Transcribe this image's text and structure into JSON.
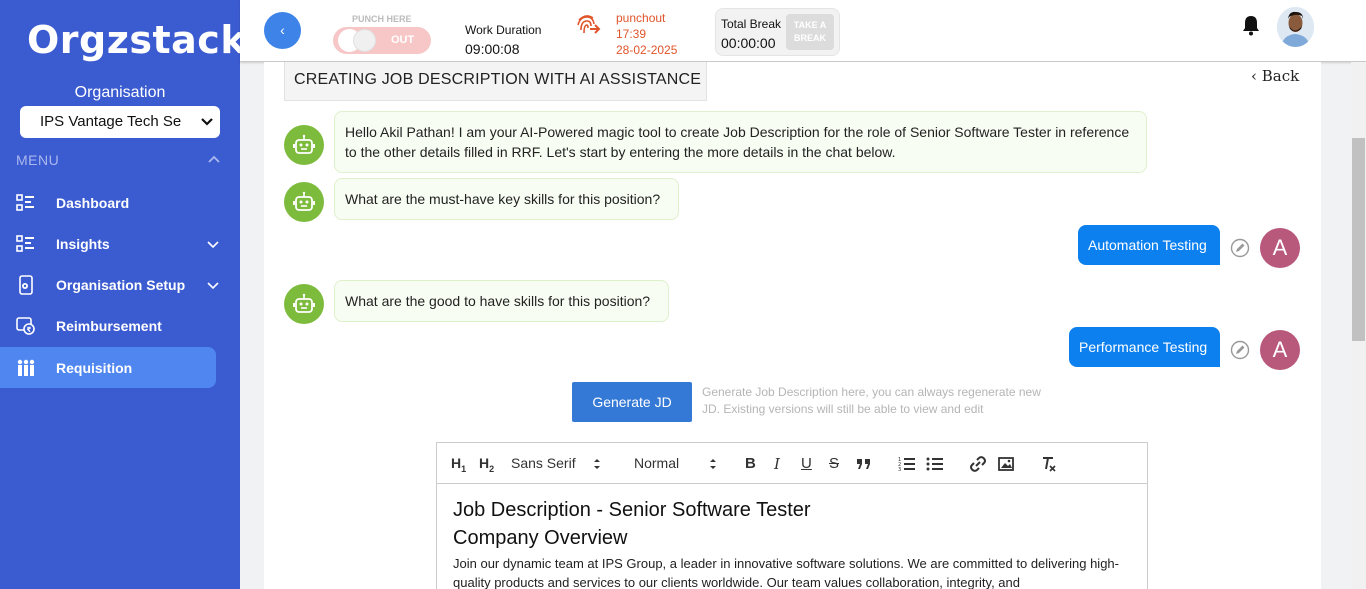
{
  "sidebar": {
    "logo": "Orgzstack",
    "org_label": "Organisation",
    "org_selected": "IPS Vantage Tech Se",
    "menu_label": "MENU",
    "items": [
      {
        "label": "Dashboard",
        "icon": "dashboard-icon"
      },
      {
        "label": "Insights",
        "icon": "insights-icon"
      },
      {
        "label": "Organisation Setup",
        "icon": "organisation-setup-icon"
      },
      {
        "label": "Reimbursement",
        "icon": "reimbursement-icon"
      },
      {
        "label": "Requisition",
        "icon": "requisition-icon"
      }
    ]
  },
  "header": {
    "back_glyph": "‹",
    "punch_label": "PUNCH HERE",
    "punch_state": "OUT",
    "work_duration_label": "Work Duration",
    "work_duration_value": "09:00:08",
    "punchout_label": "punchout",
    "punchout_time": "17:39",
    "punchout_date": "28-02-2025",
    "total_break_label": "Total Break",
    "total_break_value": "00:00:00",
    "take_break_line1": "TAKE A",
    "take_break_line2": "BREAK"
  },
  "page": {
    "title": "CREATING JOB DESCRIPTION WITH AI ASSISTANCE",
    "back_label": "Back"
  },
  "chat": {
    "bot_messages": [
      "Hello Akil Pathan! I am your AI-Powered magic tool to create Job Description for the role of Senior Software Tester in reference to the other details filled in RRF. Let's start by entering the more details in the chat below.",
      "What are the must-have key skills for this position?",
      "What are the good to have skills for this position?"
    ],
    "user_messages": [
      "Automation Testing",
      "Performance Testing"
    ],
    "user_initial": "A"
  },
  "generate": {
    "button_label": "Generate JD",
    "note": "Generate Job Description here, you can always regenerate new JD. Existing versions will still be able to view and edit"
  },
  "editor": {
    "font_select": "Sans Serif",
    "size_select": "Normal",
    "heading1": "Job Description - Senior Software Tester",
    "heading2": "Company Overview",
    "paragraph": "Join our dynamic team at IPS Group, a leader in innovative software solutions. We are committed to delivering high-quality products and services to our clients worldwide. Our team values collaboration, integrity, and"
  },
  "colors": {
    "sidebar": "#3b5bd0",
    "active_nav": "#4f86f0",
    "user_bubble": "#0d80ef",
    "bot_avatar": "#7dbb3d",
    "user_avatar": "#b8587a",
    "punchout": "#e0552b"
  }
}
